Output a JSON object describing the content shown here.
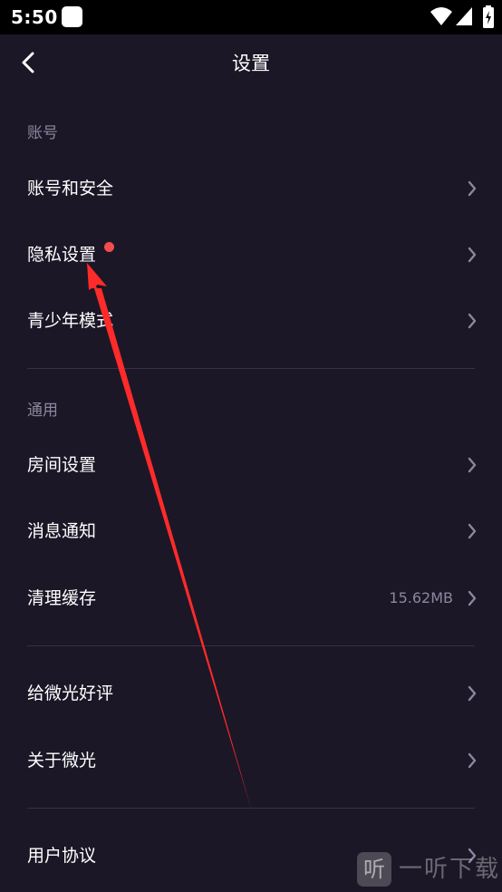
{
  "status_bar": {
    "time": "5:50",
    "icons": [
      "app-notification-icon",
      "wifi-icon",
      "signal-icon",
      "battery-charging-icon"
    ]
  },
  "header": {
    "title": "设置",
    "back_icon": "chevron-left-icon"
  },
  "sections": [
    {
      "label": "账号",
      "items": [
        {
          "label": "账号和安全"
        },
        {
          "label": "隐私设置",
          "badge": "red-dot"
        },
        {
          "label": "青少年模式"
        }
      ]
    },
    {
      "label": "通用",
      "items": [
        {
          "label": "房间设置"
        },
        {
          "label": "消息通知"
        },
        {
          "label": "清理缓存",
          "value": "15.62MB"
        }
      ]
    },
    {
      "label": "",
      "items": [
        {
          "label": "给微光好评"
        },
        {
          "label": "关于微光"
        }
      ]
    },
    {
      "label": "",
      "items": [
        {
          "label": "用户协议"
        }
      ]
    }
  ],
  "watermark": {
    "logo_glyph": "听",
    "text": "一听下载"
  },
  "colors": {
    "background": "#1b1726",
    "status_bar": "#000000",
    "text_primary": "#ffffff",
    "text_secondary": "#8c879e",
    "divider": "#34304a",
    "badge": "#f04d4d",
    "annotation_arrow": "#ff2a2a"
  }
}
